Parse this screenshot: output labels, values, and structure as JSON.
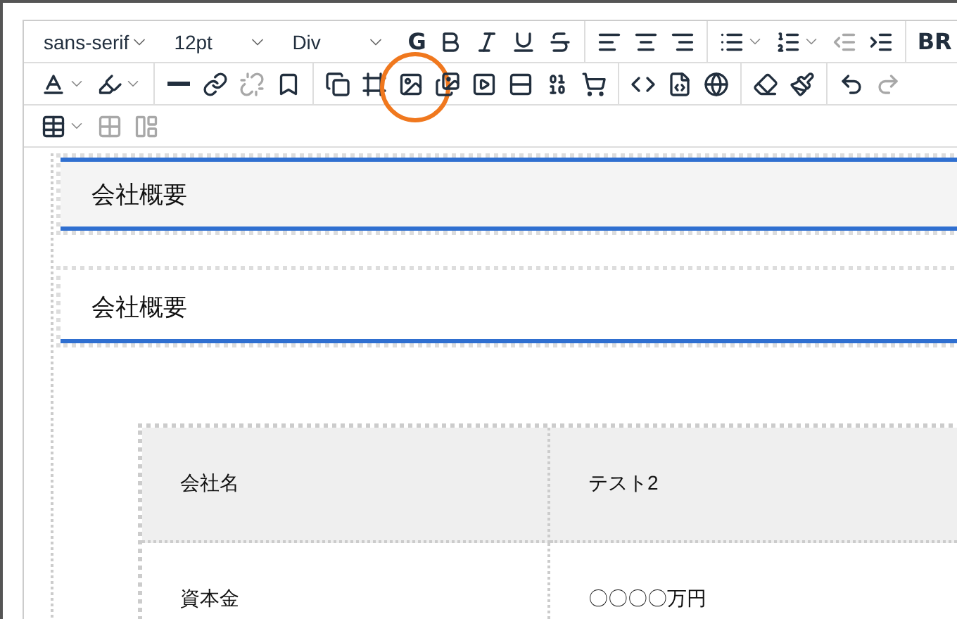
{
  "toolbar": {
    "rows": [
      [
        [
          {
            "kind": "select",
            "value": "sans-serif"
          },
          {
            "kind": "select",
            "value": "12pt"
          },
          {
            "kind": "select",
            "value": "Div"
          },
          {
            "kind": "text",
            "label": "G",
            "disabled": false
          },
          {
            "kind": "icon",
            "disabled": false
          },
          {
            "kind": "icon",
            "disabled": false
          },
          {
            "kind": "icon",
            "disabled": false
          },
          {
            "kind": "icon",
            "disabled": false
          }
        ],
        [
          {
            "kind": "icon",
            "disabled": false
          },
          {
            "kind": "icon",
            "disabled": false
          },
          {
            "kind": "icon",
            "disabled": false
          }
        ],
        [
          {
            "kind": "icon",
            "disabled": false,
            "menu": true
          },
          {
            "kind": "icon",
            "disabled": false,
            "menu": true
          },
          {
            "kind": "icon",
            "disabled": true
          },
          {
            "kind": "icon",
            "disabled": false
          }
        ],
        [
          {
            "kind": "text",
            "label": "BR",
            "disabled": false
          }
        ]
      ],
      [
        [
          {
            "kind": "icon",
            "disabled": false,
            "menu": true
          },
          {
            "kind": "icon",
            "disabled": false,
            "menu": true
          }
        ],
        [
          {
            "kind": "icon",
            "disabled": false
          },
          {
            "kind": "icon",
            "disabled": false
          },
          {
            "kind": "icon",
            "disabled": true
          },
          {
            "kind": "icon",
            "disabled": false
          }
        ],
        [
          {
            "kind": "icon",
            "disabled": false
          },
          {
            "kind": "icon",
            "disabled": false
          },
          {
            "kind": "icon",
            "disabled": false,
            "annotated": true
          },
          {
            "kind": "icon",
            "disabled": false
          },
          {
            "kind": "icon",
            "disabled": false
          },
          {
            "kind": "icon",
            "disabled": false
          },
          {
            "kind": "icon",
            "disabled": false
          },
          {
            "kind": "icon",
            "disabled": false
          }
        ],
        [
          {
            "kind": "icon",
            "disabled": false
          },
          {
            "kind": "icon",
            "disabled": false
          },
          {
            "kind": "icon",
            "disabled": false
          }
        ],
        [
          {
            "kind": "icon",
            "disabled": false
          },
          {
            "kind": "icon",
            "disabled": false
          }
        ],
        [
          {
            "kind": "icon",
            "disabled": false
          },
          {
            "kind": "icon",
            "disabled": true
          }
        ]
      ],
      [
        [
          {
            "kind": "icon",
            "disabled": false,
            "menu": true
          },
          {
            "kind": "icon",
            "disabled": true
          },
          {
            "kind": "icon",
            "disabled": true
          }
        ]
      ]
    ]
  },
  "content": {
    "headings": [
      {
        "text": "会社概要",
        "shaded": true
      },
      {
        "text": "会社概要",
        "shaded": false
      }
    ],
    "table": {
      "rows": [
        {
          "cells": [
            "会社名",
            "テスト2"
          ],
          "shaded": true
        },
        {
          "cells": [
            "資本金",
            "〇〇〇〇万円"
          ],
          "shaded": false
        }
      ]
    }
  }
}
